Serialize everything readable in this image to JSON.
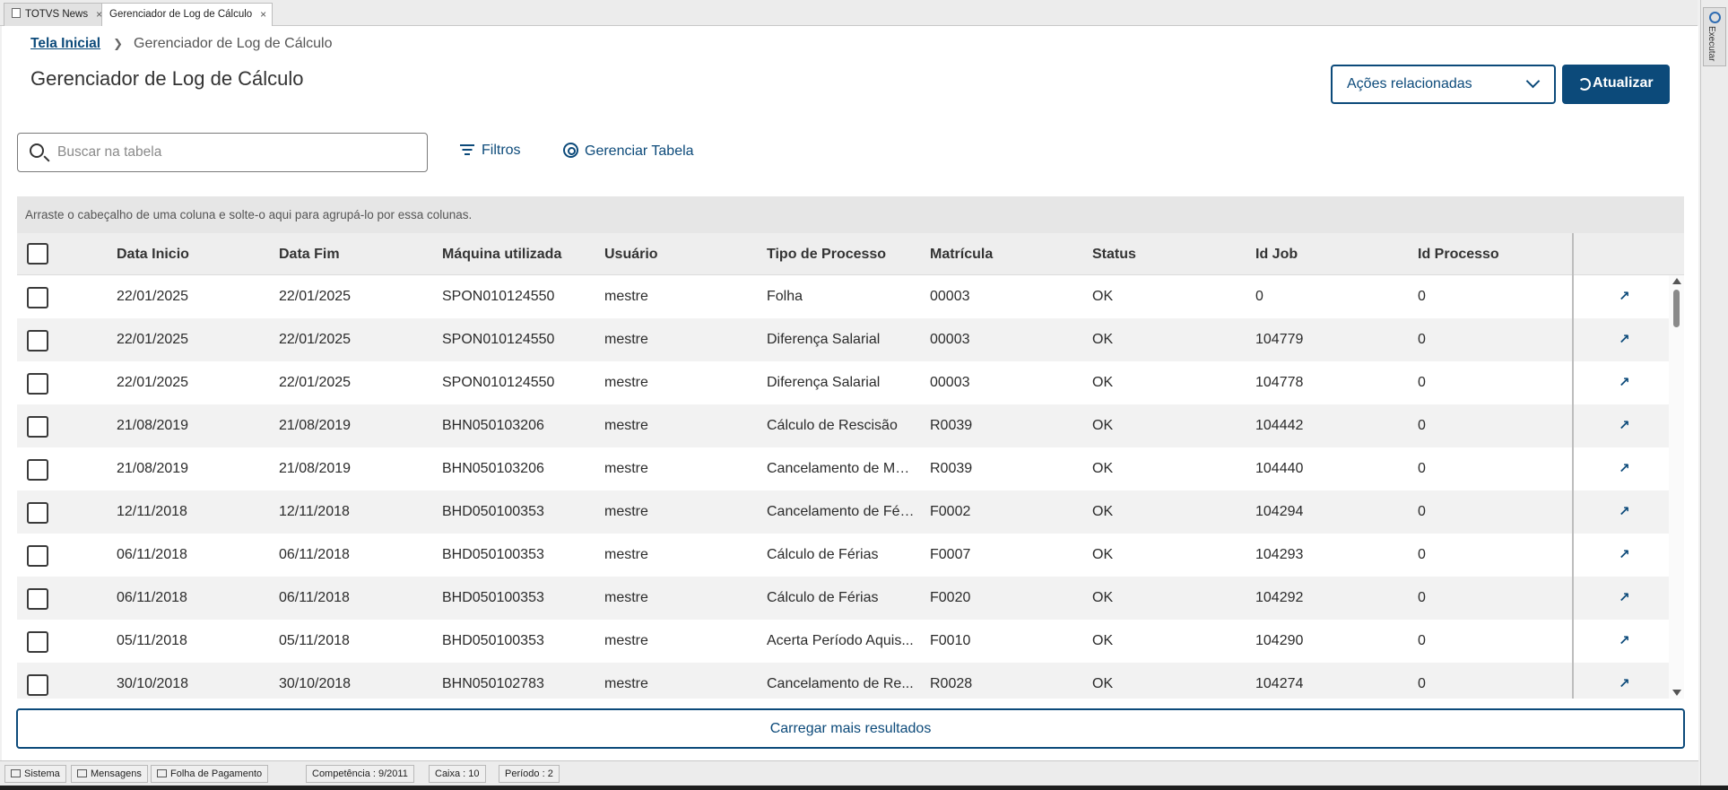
{
  "window_tabs": [
    {
      "label": "TOTVS News",
      "active": false
    },
    {
      "label": "Gerenciador de Log de Cálculo",
      "active": true
    }
  ],
  "side_panel": {
    "execute_label": "Executar"
  },
  "breadcrumb": {
    "home": "Tela Inicial",
    "current": "Gerenciador de Log de Cálculo"
  },
  "page_title": "Gerenciador de Log de Cálculo",
  "actions": {
    "related_label": "Ações relacionadas",
    "refresh_label": "Atualizar"
  },
  "toolbar": {
    "search_placeholder": "Buscar na tabela",
    "filters_label": "Filtros",
    "manage_label": "Gerenciar Tabela"
  },
  "table": {
    "group_hint": "Arraste o cabeçalho de uma coluna e solte-o aqui para agrupá-lo por essa colunas.",
    "columns": [
      "Data Inicio",
      "Data Fim",
      "Máquina utilizada",
      "Usuário",
      "Tipo de Processo",
      "Matrícula",
      "Status",
      "Id Job",
      "Id Processo"
    ],
    "rows": [
      [
        "22/01/2025",
        "22/01/2025",
        "SPON010124550",
        "mestre",
        "Folha",
        "00003",
        "OK",
        "0",
        "0"
      ],
      [
        "22/01/2025",
        "22/01/2025",
        "SPON010124550",
        "mestre",
        "Diferença Salarial",
        "00003",
        "OK",
        "104779",
        "0"
      ],
      [
        "22/01/2025",
        "22/01/2025",
        "SPON010124550",
        "mestre",
        "Diferença Salarial",
        "00003",
        "OK",
        "104778",
        "0"
      ],
      [
        "21/08/2019",
        "21/08/2019",
        "BHN050103206",
        "mestre",
        "Cálculo de Rescisão",
        "R0039",
        "OK",
        "104442",
        "0"
      ],
      [
        "21/08/2019",
        "21/08/2019",
        "BHN050103206",
        "mestre",
        "Cancelamento de Mo...",
        "R0039",
        "OK",
        "104440",
        "0"
      ],
      [
        "12/11/2018",
        "12/11/2018",
        "BHD050100353",
        "mestre",
        "Cancelamento de Fér...",
        "F0002",
        "OK",
        "104294",
        "0"
      ],
      [
        "06/11/2018",
        "06/11/2018",
        "BHD050100353",
        "mestre",
        "Cálculo de Férias",
        "F0007",
        "OK",
        "104293",
        "0"
      ],
      [
        "06/11/2018",
        "06/11/2018",
        "BHD050100353",
        "mestre",
        "Cálculo de Férias",
        "F0020",
        "OK",
        "104292",
        "0"
      ],
      [
        "05/11/2018",
        "05/11/2018",
        "BHD050100353",
        "mestre",
        "Acerta Período Aquis...",
        "F0010",
        "OK",
        "104290",
        "0"
      ],
      [
        "30/10/2018",
        "30/10/2018",
        "BHN050102783",
        "mestre",
        "Cancelamento de Re...",
        "R0028",
        "OK",
        "104274",
        "0"
      ]
    ],
    "load_more": "Carregar mais resultados"
  },
  "statusbar": {
    "sistema": "Sistema",
    "mensagens": "Mensagens",
    "modulo": "Folha de Pagamento",
    "competencia": "Competência : 9/2011",
    "caixa": "Caixa : 10",
    "periodo": "Período : 2"
  },
  "colors": {
    "accent": "#0c4a7a",
    "row_alt": "#f2f2f2",
    "header_bg": "#eeeeee"
  }
}
